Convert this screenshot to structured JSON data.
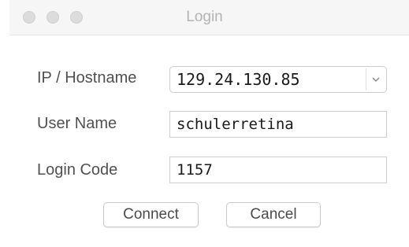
{
  "window": {
    "title": "Login"
  },
  "form": {
    "host_label": "IP / Hostname",
    "host_value": "129.24.130.85",
    "user_label": "User Name",
    "user_value": "schulerretina",
    "code_label": "Login Code",
    "code_value": "1157"
  },
  "buttons": {
    "connect": "Connect",
    "cancel": "Cancel"
  },
  "icons": {
    "host_dropdown": "chevron-down-icon",
    "close": "close-traffic-light",
    "minimize": "minimize-traffic-light",
    "zoom": "zoom-traffic-light"
  },
  "colors": {
    "titlebar": "#f6f6f6",
    "title_text": "#b3b3b3",
    "traffic_inactive": "#dcdcdc",
    "label_text": "#505050",
    "field_border": "#cdcdcd"
  }
}
